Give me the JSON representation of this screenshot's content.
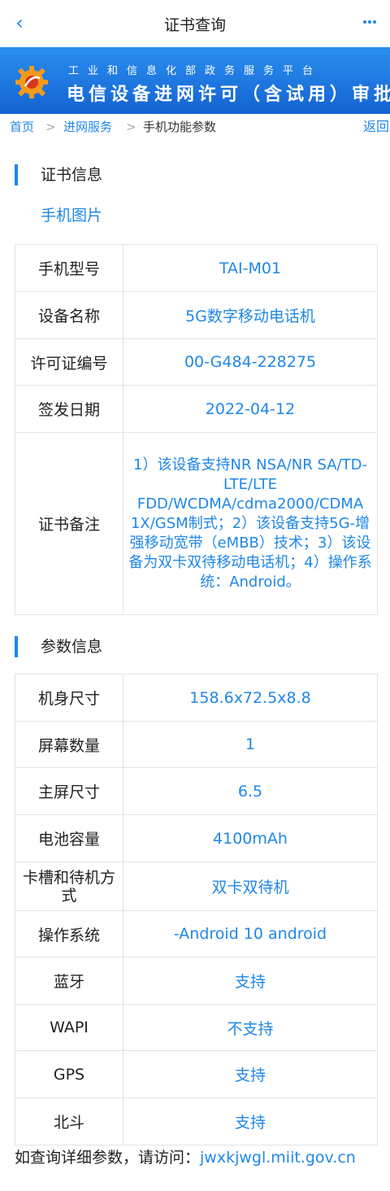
{
  "nav": {
    "back_icon": "chevron-left-icon",
    "title": "证书查询",
    "more_icon": "more-dots-icon"
  },
  "banner": {
    "logo_icon": "gear-logo-icon",
    "subtitle": "工业和信息化部政务服务平台",
    "title": "电信设备进网许可（含试用）审批"
  },
  "breadcrumb": {
    "home": "首页",
    "separator": ">",
    "service": "进网服务",
    "current": "手机功能参数",
    "return": "返回"
  },
  "certificate": {
    "section_title": "证书信息",
    "photo_link": "手机图片",
    "rows": [
      {
        "key": "手机型号",
        "value": "TAI-M01"
      },
      {
        "key": "设备名称",
        "value": "5G数字移动电话机"
      },
      {
        "key": "许可证编号",
        "value": "00-G484-228275"
      },
      {
        "key": "签发日期",
        "value": "2022-04-12"
      },
      {
        "key": "证书备注",
        "value": "1）该设备支持NR NSA/NR SA/TD-LTE/LTE FDD/WCDMA/cdma2000/CDMA 1X/GSM制式；2）该设备支持5G-增强移动宽带（eMBB）技术；3）该设备为双卡双待移动电话机；4）操作系统：Android。"
      }
    ]
  },
  "params": {
    "section_title": "参数信息",
    "rows": [
      {
        "key": "机身尺寸",
        "value": "158.6x72.5x8.8"
      },
      {
        "key": "屏幕数量",
        "value": "1"
      },
      {
        "key": "主屏尺寸",
        "value": "6.5"
      },
      {
        "key": "电池容量",
        "value": "4100mAh"
      },
      {
        "key": "卡槽和待机方式",
        "value": "双卡双待机"
      },
      {
        "key": "操作系统",
        "value": "-Android 10 android"
      },
      {
        "key": "蓝牙",
        "value": "支持"
      },
      {
        "key": "WAPI",
        "value": "不支持"
      },
      {
        "key": "GPS",
        "value": "支持"
      },
      {
        "key": "北斗",
        "value": "支持"
      }
    ]
  },
  "footer": {
    "text": "如查询详细参数，请访问：",
    "url": "jwxkjwgl.miit.gov.cn"
  },
  "colors": {
    "accent": "#1f87e8",
    "banner_top": "#2a8ff0",
    "banner_bottom": "#1463d2",
    "border": "#e3e3e3"
  }
}
